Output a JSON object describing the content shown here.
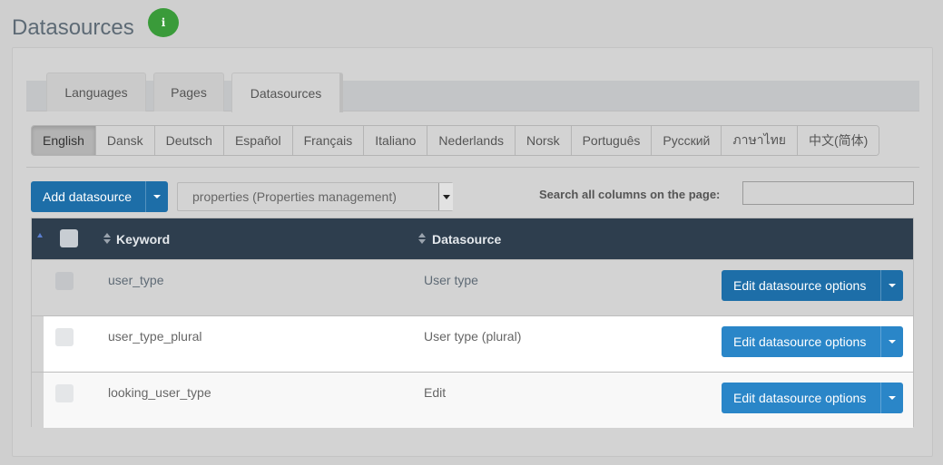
{
  "page": {
    "title": "Datasources",
    "info_icon": "info-icon"
  },
  "tabs": [
    {
      "label": "Languages",
      "active": false
    },
    {
      "label": "Pages",
      "active": false
    },
    {
      "label": "Datasources",
      "active": true
    }
  ],
  "languages": [
    "English",
    "Dansk",
    "Deutsch",
    "Español",
    "Français",
    "Italiano",
    "Nederlands",
    "Norsk",
    "Português",
    "Русский",
    "ภาษาไทย",
    "中文(简体)"
  ],
  "active_language": "English",
  "toolbar": {
    "add_label": "Add datasource",
    "select_value": "properties (Properties management)",
    "search_label": "Search all columns on the page:",
    "search_value": ""
  },
  "table": {
    "columns": {
      "keyword": "Keyword",
      "datasource": "Datasource"
    },
    "rows": [
      {
        "keyword": "user_type",
        "datasource": "User type",
        "action": "Edit datasource options"
      },
      {
        "keyword": "user_type_plural",
        "datasource": "User type (plural)",
        "action": "Edit datasource options"
      },
      {
        "keyword": "looking_user_type",
        "datasource": "Edit",
        "action": "Edit datasource options"
      }
    ]
  },
  "colors": {
    "primary": "#1d6ea8",
    "header": "#2e3e4e",
    "badge": "#3a9b3a"
  }
}
